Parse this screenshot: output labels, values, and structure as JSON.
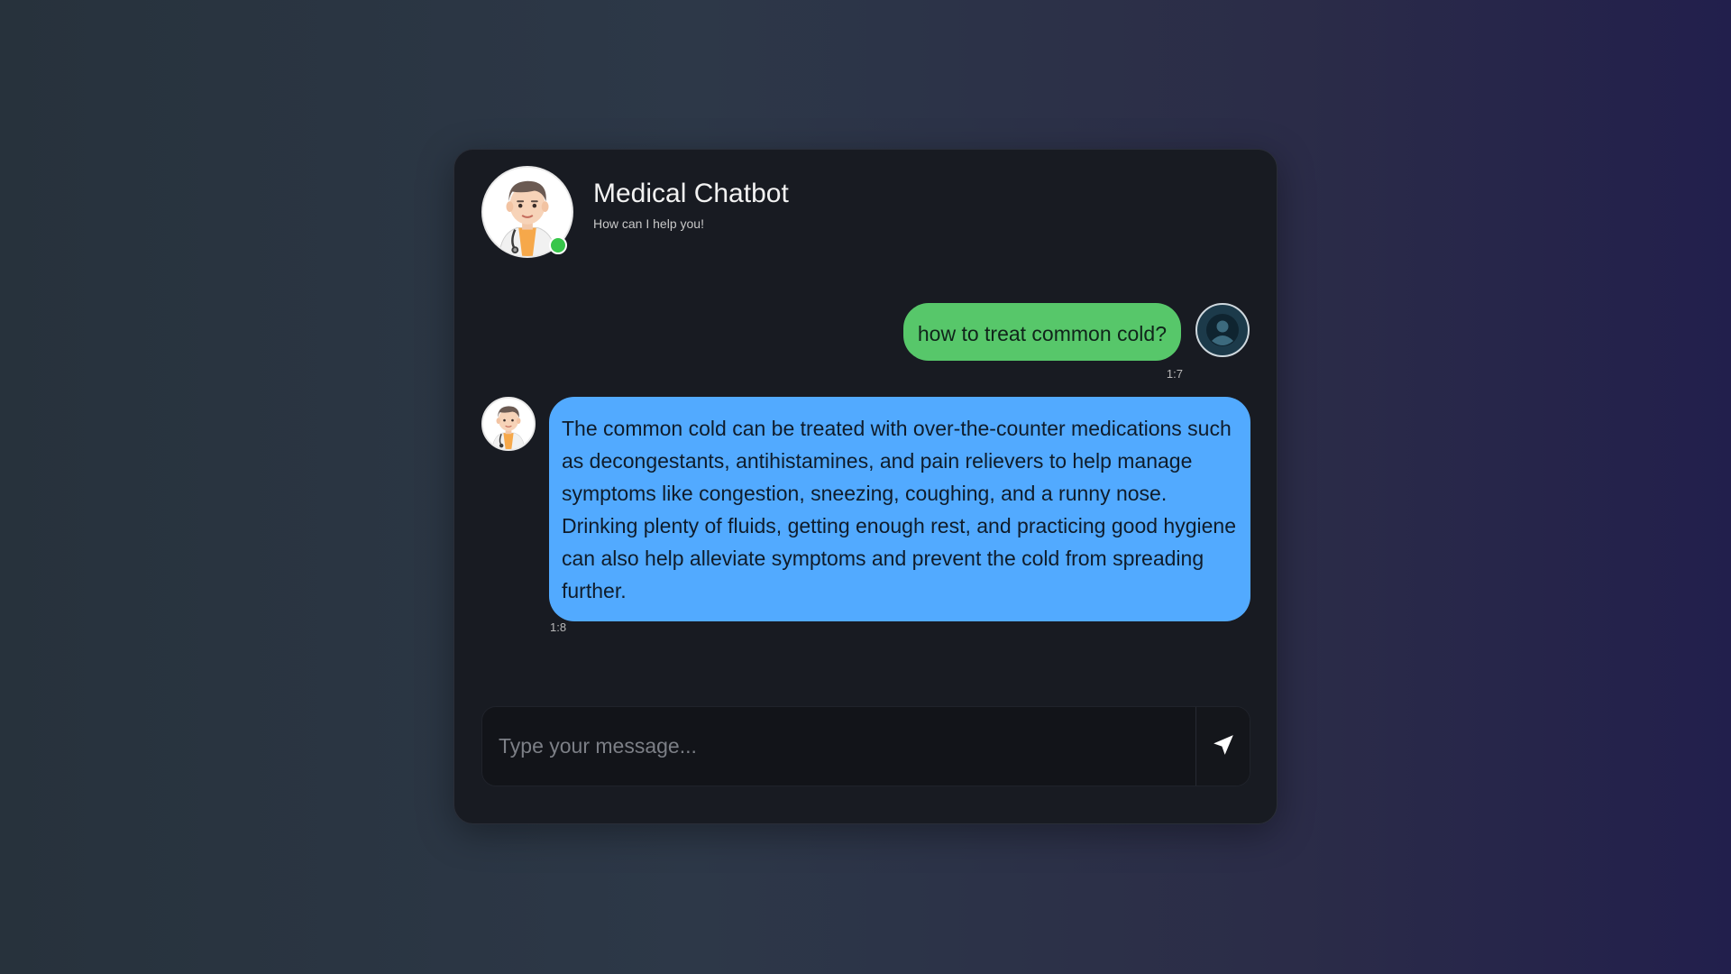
{
  "colors": {
    "card_background": "#181b22",
    "user_bubble": "#57c76a",
    "bot_bubble": "#52aaff",
    "online_status": "#37c64a",
    "composer_background": "#121419"
  },
  "header": {
    "avatar_icon": "doctor-avatar-icon",
    "status": "online",
    "title": "Medical Chatbot",
    "subtitle": "How can I help you!"
  },
  "messages": [
    {
      "sender": "user",
      "avatar_icon": "user-avatar-icon",
      "text": "how to treat common cold?",
      "time": "1:7"
    },
    {
      "sender": "bot",
      "avatar_icon": "doctor-avatar-icon",
      "text": "The common cold can be treated with over-the-counter medications such as decongestants, antihistamines, and pain relievers to help manage symptoms like congestion, sneezing, coughing, and a runny nose. Drinking plenty of fluids, getting enough rest, and practicing good hygiene can also help alleviate symptoms and prevent the cold from spreading further.",
      "time": "1:8"
    }
  ],
  "composer": {
    "value": "",
    "placeholder": "Type your message...",
    "send_icon": "send-arrow-icon"
  }
}
